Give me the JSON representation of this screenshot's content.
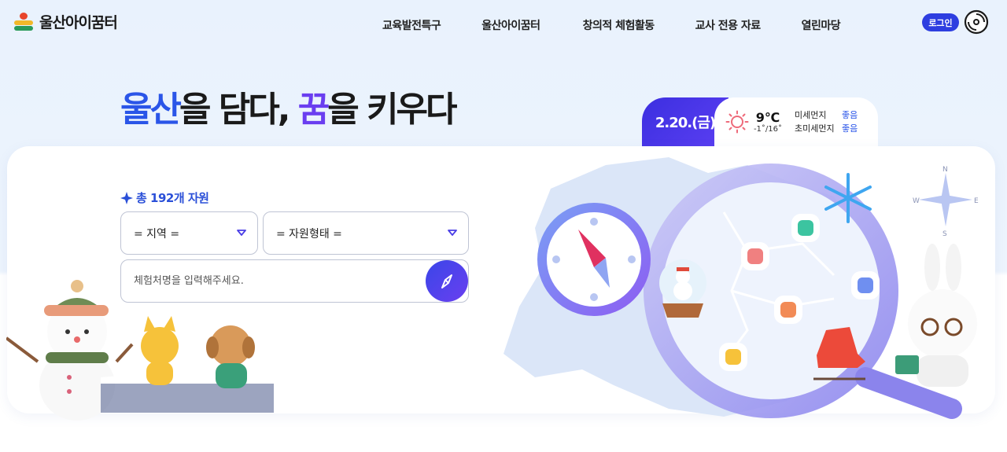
{
  "header": {
    "logo_text": "울산아이꿈터",
    "nav": [
      "교육발전특구",
      "울산아이꿈터",
      "창의적 체험활동",
      "교사 전용 자료",
      "열린마당"
    ],
    "login_label": "로그인"
  },
  "hero": {
    "title_part1": "울산",
    "title_part2": "을 담다, ",
    "title_part3": "꿈",
    "title_part4": "을 키우다"
  },
  "weather": {
    "date": "2.20.(금)",
    "temp": "9℃",
    "temp_range": "-1˚/16˚",
    "fine_dust_label": "미세먼지",
    "fine_dust_value": "좋음",
    "ultra_fine_dust_label": "초미세먼지",
    "ultra_fine_dust_value": "좋음"
  },
  "search": {
    "total_label": "총 192개 자원",
    "region_select": "= 지역 =",
    "type_select": "= 자원형태 =",
    "input_placeholder": "체험처명을 입력해주세요."
  },
  "compass_rose": {
    "n": "N",
    "e": "E",
    "s": "S",
    "w": "W"
  },
  "colors": {
    "primary_blue": "#2a55e8",
    "purple": "#6a3ef0",
    "login_bg": "#2e3ee0",
    "date_tab_bg": "#3c2fe0"
  }
}
